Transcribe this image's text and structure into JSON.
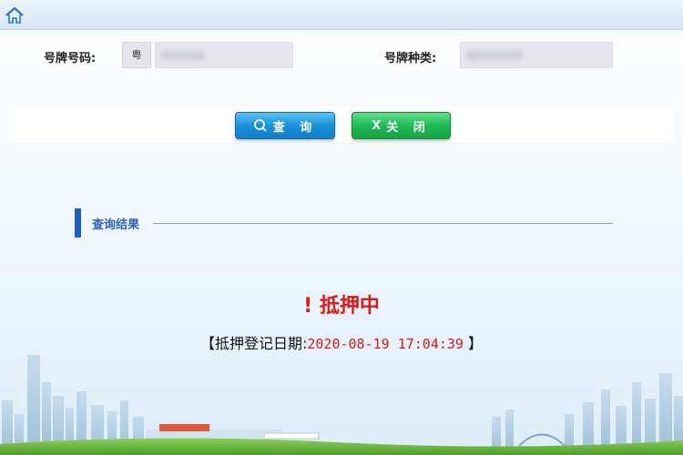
{
  "header": {
    "home_icon": "home-icon"
  },
  "form": {
    "plate_number_label": "号牌号码:",
    "province_prefix": "粤",
    "plate_type_label": "号牌种类:"
  },
  "buttons": {
    "query_label": "查 询",
    "query_icon": "search-icon",
    "close_label": "关 闭",
    "close_icon_text": "X"
  },
  "results": {
    "section_title": "查询结果",
    "status_mark": "!",
    "status_text": "抵押中",
    "reg_prefix": "【抵押登记日期:",
    "reg_date": "2020-08-19 17:04:39",
    "reg_suffix": " 】"
  },
  "colors": {
    "accent_blue": "#1c5fc4",
    "status_red": "#e01818",
    "query_button": "#1a92db",
    "close_button": "#1ebb55"
  }
}
